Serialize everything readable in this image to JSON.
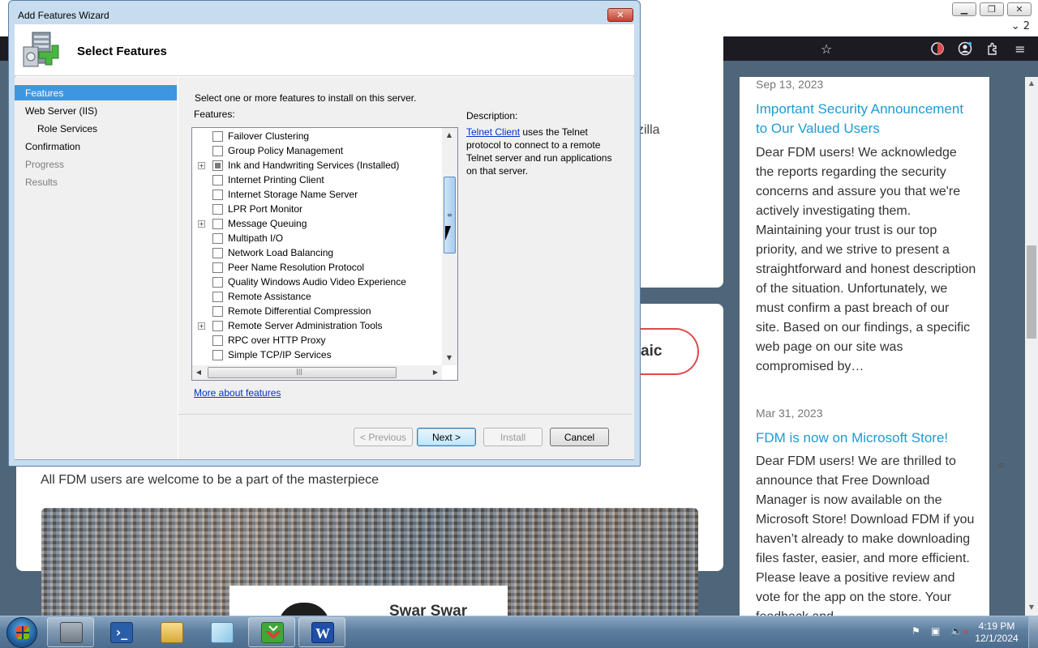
{
  "browser": {
    "tab_count": "2",
    "window_controls": {
      "minimize": "▁",
      "restore": "❐",
      "close": "✕"
    },
    "toolbar_icons": [
      "star-icon",
      "extension-status-icon",
      "account-icon",
      "extensions-icon",
      "menu-icon"
    ]
  },
  "page": {
    "zilla_text": "zilla",
    "pill_text": "aic",
    "welcome_text": "All FDM users are welcome to be a part of the masterpiece",
    "mosaic_caption": "Swar Swar"
  },
  "news": [
    {
      "date": "Sep 13, 2023",
      "title": "Important Security Announcement to Our Valued Users",
      "body": "Dear FDM users! We acknowledge the reports regarding the security concerns and assure you that we're actively investigating them. Maintaining your trust is our top priority, and we strive to present a straightforward and honest description of the situation. Unfortunately, we must confirm a past breach of our site. Based on our findings, a specific web page on our site was compromised by…"
    },
    {
      "date": "Mar 31, 2023",
      "title": "FDM is now on Microsoft Store!",
      "body": "Dear FDM users! We are thrilled to announce that Free Download Manager is now available on the Microsoft Store! Download FDM if you haven’t already to make downloading files faster, easier, and more efficient. Please leave a positive review and vote for the app on the store. Your feedback and"
    }
  ],
  "wizard": {
    "window_title": "Add Features Wizard",
    "heading": "Select Features",
    "nav": [
      {
        "label": "Features",
        "state": "active"
      },
      {
        "label": "Web Server (IIS)",
        "state": "normal"
      },
      {
        "label": "Role Services",
        "state": "normal"
      },
      {
        "label": "Confirmation",
        "state": "normal"
      },
      {
        "label": "Progress",
        "state": "disabled"
      },
      {
        "label": "Results",
        "state": "disabled"
      }
    ],
    "instruction": "Select one or more features to install on this server.",
    "features_label": "Features:",
    "features": [
      {
        "label": "Failover Clustering",
        "expandable": false,
        "installed": false
      },
      {
        "label": "Group Policy Management",
        "expandable": false,
        "installed": false
      },
      {
        "label": "Ink and Handwriting Services  (Installed)",
        "expandable": true,
        "installed": true
      },
      {
        "label": "Internet Printing Client",
        "expandable": false,
        "installed": false
      },
      {
        "label": "Internet Storage Name Server",
        "expandable": false,
        "installed": false
      },
      {
        "label": "LPR Port Monitor",
        "expandable": false,
        "installed": false
      },
      {
        "label": "Message Queuing",
        "expandable": true,
        "installed": false
      },
      {
        "label": "Multipath I/O",
        "expandable": false,
        "installed": false
      },
      {
        "label": "Network Load Balancing",
        "expandable": false,
        "installed": false
      },
      {
        "label": "Peer Name Resolution Protocol",
        "expandable": false,
        "installed": false
      },
      {
        "label": "Quality Windows Audio Video Experience",
        "expandable": false,
        "installed": false
      },
      {
        "label": "Remote Assistance",
        "expandable": false,
        "installed": false
      },
      {
        "label": "Remote Differential Compression",
        "expandable": false,
        "installed": false
      },
      {
        "label": "Remote Server Administration Tools",
        "expandable": true,
        "installed": false
      },
      {
        "label": "RPC over HTTP Proxy",
        "expandable": false,
        "installed": false
      },
      {
        "label": "Simple TCP/IP Services",
        "expandable": false,
        "installed": false
      }
    ],
    "description_label": "Description:",
    "description_link": "Telnet Client",
    "description_text": " uses the Telnet protocol to connect to a remote Telnet server and run applications on that server.",
    "more_link": "More about features",
    "buttons": {
      "previous": "< Previous",
      "next": "Next >",
      "install": "Install",
      "cancel": "Cancel"
    }
  },
  "taskbar": {
    "apps": [
      "server-manager-icon",
      "powershell-icon",
      "file-explorer-icon",
      "notepad-icon",
      "fdm-icon",
      "word-icon"
    ],
    "clock_time": "4:19 PM",
    "clock_date": "12/1/2024"
  }
}
